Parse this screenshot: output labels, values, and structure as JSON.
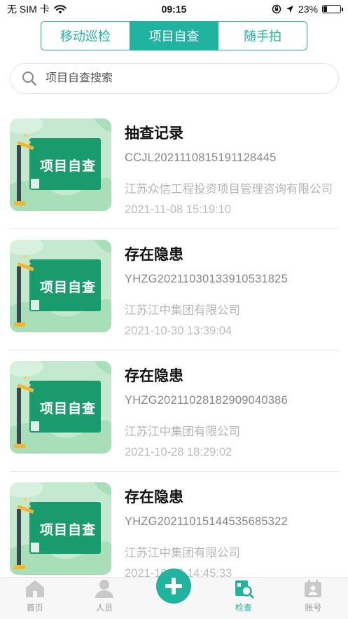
{
  "status_bar": {
    "carrier": "无 SIM 卡",
    "time": "09:15",
    "battery": "23%",
    "battery_level": 0.23,
    "icons": [
      "wifi-icon",
      "orientation-lock-icon",
      "location-arrow-icon",
      "battery-icon"
    ]
  },
  "tabs": [
    {
      "label": "移动巡检",
      "active": false
    },
    {
      "label": "项目自查",
      "active": true
    },
    {
      "label": "随手拍",
      "active": false
    }
  ],
  "search": {
    "placeholder": "项目自查搜索",
    "value": "",
    "icon": "search-icon"
  },
  "records": [
    {
      "thumb_label": "项目自查",
      "title": "抽查记录",
      "code": "CCJL2021110815191128445",
      "company": "江苏众信工程投资项目管理咨询有限公司",
      "date": "2021-11-08 15:19:10"
    },
    {
      "thumb_label": "项目自查",
      "title": "存在隐患",
      "code": "YHZG2021103013391053182​5",
      "company": "江苏江中集团有限公司",
      "date": "2021-10-30 13:39:04"
    },
    {
      "thumb_label": "项目自查",
      "title": "存在隐患",
      "code": "YHZG2021102818290904038​6",
      "company": "江苏江中集团有限公司",
      "date": "2021-10-28 18:29:02"
    },
    {
      "thumb_label": "项目自查",
      "title": "存在隐患",
      "code": "YHZG2021101514453568532​2",
      "company": "江苏江中集团有限公司",
      "date": "2021-10-15 14:45:33"
    }
  ],
  "bottom_nav": [
    {
      "label": "首页",
      "icon": "home-icon",
      "active": false
    },
    {
      "label": "人员",
      "icon": "person-icon",
      "active": false
    },
    {
      "label": "",
      "icon": "plus-icon",
      "active": false
    },
    {
      "label": "检查",
      "icon": "inspect-icon",
      "active": true
    },
    {
      "label": "账号",
      "icon": "account-icon",
      "active": false
    }
  ],
  "colors": {
    "accent": "#1fb3a0",
    "thumb_board": "#1a9b6e",
    "thumb_bg": "#bfe6c9"
  }
}
